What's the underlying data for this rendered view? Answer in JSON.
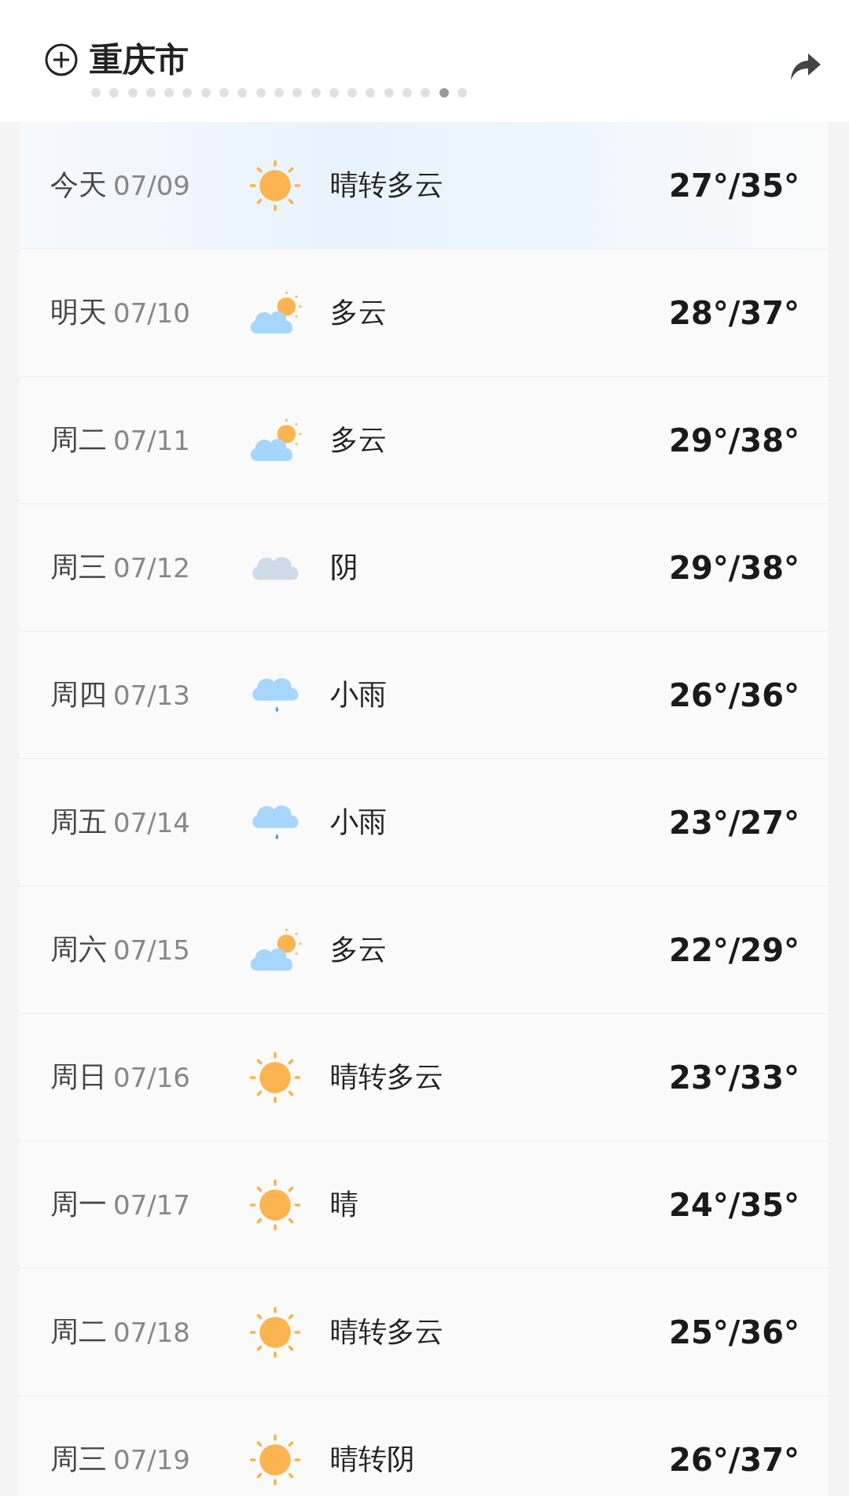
{
  "header": {
    "city": "重庆市",
    "pages": [
      {
        "selected": false
      },
      {
        "selected": false
      },
      {
        "selected": false
      },
      {
        "selected": false
      },
      {
        "selected": false
      },
      {
        "selected": false
      },
      {
        "selected": false
      },
      {
        "selected": false
      },
      {
        "selected": false
      },
      {
        "selected": false
      },
      {
        "selected": false
      },
      {
        "selected": false
      },
      {
        "selected": false
      },
      {
        "selected": false
      },
      {
        "selected": false
      },
      {
        "selected": false
      },
      {
        "selected": false
      },
      {
        "selected": false
      },
      {
        "selected": false
      },
      {
        "selected": true
      },
      {
        "selected": false
      }
    ]
  },
  "forecast": [
    {
      "day": "今天",
      "date": "07/09",
      "kind": "sunny",
      "condition": "晴转多云",
      "temp": "27°/35°",
      "selected": true
    },
    {
      "day": "明天",
      "date": "07/10",
      "kind": "partly-cloudy",
      "condition": "多云",
      "temp": "28°/37°",
      "selected": false
    },
    {
      "day": "周二",
      "date": "07/11",
      "kind": "partly-cloudy",
      "condition": "多云",
      "temp": "29°/38°",
      "selected": false
    },
    {
      "day": "周三",
      "date": "07/12",
      "kind": "overcast",
      "condition": "阴",
      "temp": "29°/38°",
      "selected": false
    },
    {
      "day": "周四",
      "date": "07/13",
      "kind": "rain",
      "condition": "小雨",
      "temp": "26°/36°",
      "selected": false
    },
    {
      "day": "周五",
      "date": "07/14",
      "kind": "rain",
      "condition": "小雨",
      "temp": "23°/27°",
      "selected": false
    },
    {
      "day": "周六",
      "date": "07/15",
      "kind": "partly-cloudy",
      "condition": "多云",
      "temp": "22°/29°",
      "selected": false
    },
    {
      "day": "周日",
      "date": "07/16",
      "kind": "sunny",
      "condition": "晴转多云",
      "temp": "23°/33°",
      "selected": false
    },
    {
      "day": "周一",
      "date": "07/17",
      "kind": "sunny",
      "condition": "晴",
      "temp": "24°/35°",
      "selected": false
    },
    {
      "day": "周二",
      "date": "07/18",
      "kind": "sunny",
      "condition": "晴转多云",
      "temp": "25°/36°",
      "selected": false
    },
    {
      "day": "周三",
      "date": "07/19",
      "kind": "sunny",
      "condition": "晴转阴",
      "temp": "26°/37°",
      "selected": false
    }
  ]
}
